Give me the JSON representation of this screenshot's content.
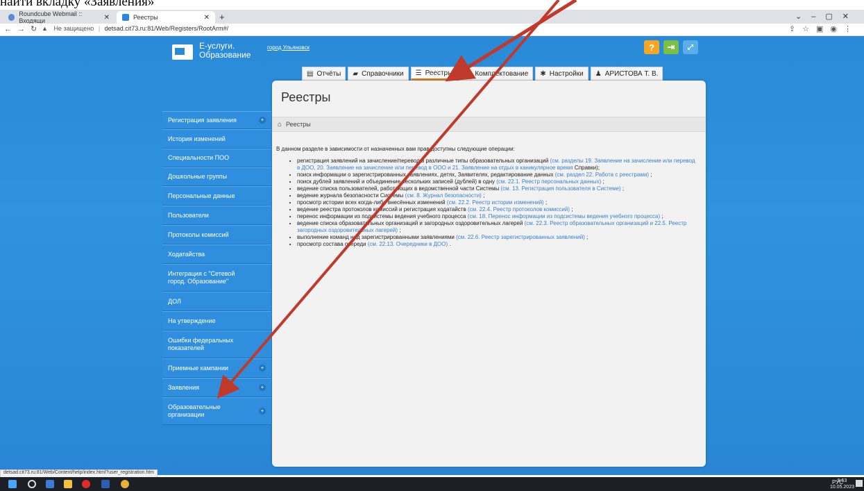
{
  "top_text": "найти вкладку «Заявления»",
  "browser": {
    "tabs": [
      {
        "title": "Roundcube Webmail :: Входящи",
        "active": false
      },
      {
        "title": "Реестры",
        "active": true
      }
    ],
    "new_tab": "+",
    "url_warning": "Не защищено",
    "url": "detsad.cit73.ru:81/Web/Registers/RootArm#/"
  },
  "header": {
    "logo_line1": "Е-услуги.",
    "logo_line2": "Образование",
    "city": "город Ульяновск",
    "help_label": "?"
  },
  "menu": [
    {
      "label": "Отчёты",
      "icon": "report-icon"
    },
    {
      "label": "Справочники",
      "icon": "book-icon"
    },
    {
      "label": "Реестры",
      "icon": "list-icon",
      "active": true
    },
    {
      "label": "Комплектование",
      "icon": "briefcase-icon"
    },
    {
      "label": "Настройки",
      "icon": "gear-icon"
    },
    {
      "label": "АРИСТОВА Т. В.",
      "icon": "user-icon"
    }
  ],
  "page": {
    "title": "Реестры",
    "breadcrumb": "Реестры",
    "intro": "В данном разделе в зависимости от назначенных вам прав доступны следующие операции:",
    "items": [
      {
        "text": "регистрация заявлений на зачисление/перевод в различные типы образовательных организаций",
        "link": "(см. разделы 19. Заявление на зачисление или перевод в ДОО, 20. Заявление на зачисление или перевод в ООО и 21. Заявление на отдых в каникулярное время",
        "tail": "Справки);"
      },
      {
        "text": "поиск информации о зарегистрированных заявлениях, детях, Заявителях, редактирование данных",
        "link": "(см. раздел 22. Работа с реестрами)",
        "tail": ";"
      },
      {
        "text": "поиск дублей заявлений и объединение нескольких записей (дублей) в одну",
        "link": "(см. 22.1. Реестр персональных данных)",
        "tail": ";"
      },
      {
        "text": "ведение списка пользователей, работающих в ведомственной части Системы",
        "link": "(см. 13. Регистрация пользователя в Системе)",
        "tail": ";"
      },
      {
        "text": "ведение журнала безопасности Системы",
        "link": "(см. 8. Журнал безопасности)",
        "tail": ";"
      },
      {
        "text": "просмотр истории всех когда-либо внесённых изменений",
        "link": "(см. 22.2. Реестр истории изменений)",
        "tail": ";"
      },
      {
        "text": "ведение реестра протоколов комиссий и регистрация ходатайств",
        "link": "(см. 22.4. Реестр протоколов комиссий)",
        "tail": ";"
      },
      {
        "text": "перенос информации из подсистемы ведения учебного процесса",
        "link": "(см. 18. Перенос информации из подсистемы ведения учебного процесса)",
        "tail": ";"
      },
      {
        "text": "ведение списка образовательных организаций и загородных оздоровительных лагерей",
        "link": "(см. 22.3. Реестр образовательных организаций и 22.5. Реестр загородных оздоровительных лагерей)",
        "tail": ";"
      },
      {
        "text": "выполнение команд над зарегистрированными заявлениями",
        "link": "(см. 22.6. Реестр зарегистрированных заявлений)",
        "tail": ";"
      },
      {
        "text": "просмотр состава очереди",
        "link": "(см. 22.13. Очередники в ДОО)",
        "tail": "."
      }
    ]
  },
  "sidebar": [
    {
      "label": "Регистрация заявления",
      "expandable": true
    },
    {
      "label": "История изменений",
      "expandable": false
    },
    {
      "label": "Специальности ПОО",
      "expandable": false
    },
    {
      "label": "Дошкольные группы",
      "expandable": false
    },
    {
      "label": "Персональные данные",
      "expandable": false
    },
    {
      "label": "Пользователи",
      "expandable": false
    },
    {
      "label": "Протоколы комиссий",
      "expandable": false
    },
    {
      "label": "Ходатайства",
      "expandable": false
    },
    {
      "label": "Интеграция с \"Сетевой город. Образование\"",
      "expandable": false
    },
    {
      "label": "ДОЛ",
      "expandable": false
    },
    {
      "label": "На утверждение",
      "expandable": false
    },
    {
      "label": "Ошибки федеральных показателей",
      "expandable": false
    },
    {
      "label": "Приемные кампании",
      "expandable": true
    },
    {
      "label": "Заявления",
      "expandable": true
    },
    {
      "label": "Образовательные организации",
      "expandable": true
    }
  ],
  "status_url": "detsad.cit73.ru:81/Web/Content/help/index.html?user_registration.htm",
  "taskbar": {
    "tray_text": "РУС",
    "time": "9:53",
    "date": "10.05.2023"
  },
  "colors": {
    "page_bg": "#2a8ad8",
    "annotation_arrow": "#c0392b",
    "active_tab_underline": "#e07b2a"
  }
}
